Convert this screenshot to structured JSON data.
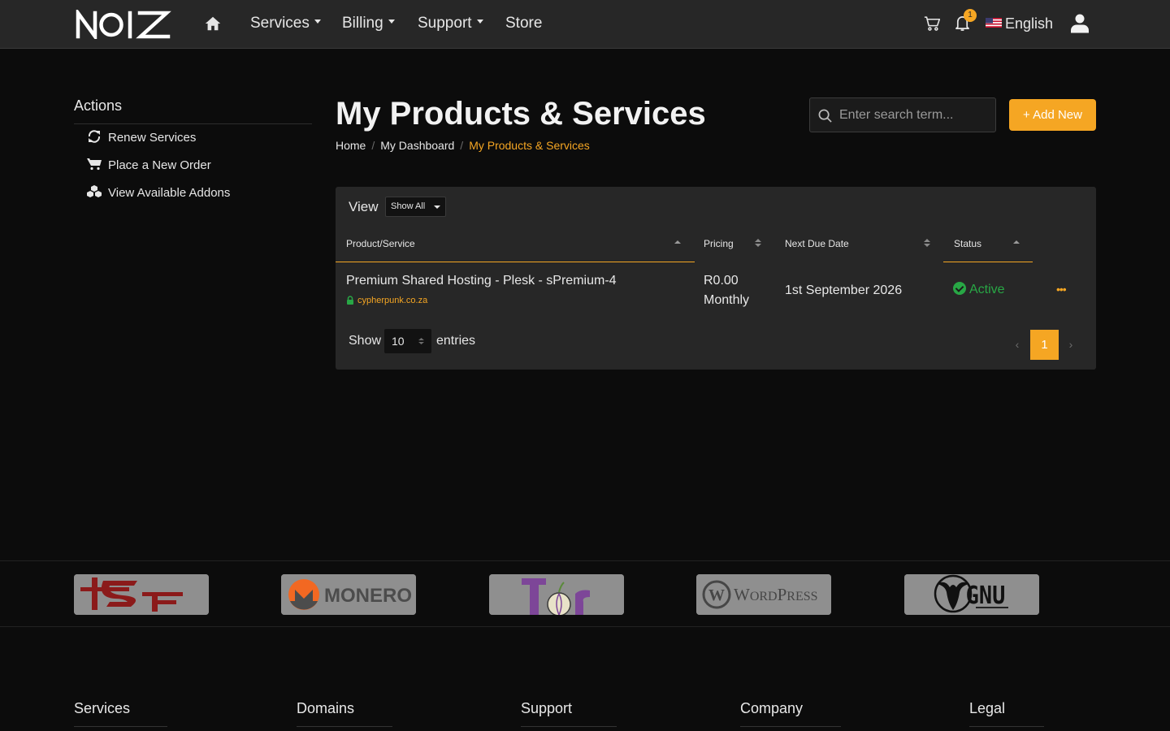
{
  "brand": {
    "logo_text": "NOIZ"
  },
  "nav": {
    "items": [
      {
        "label": "Services",
        "dropdown": true
      },
      {
        "label": "Billing",
        "dropdown": true
      },
      {
        "label": "Support",
        "dropdown": true
      },
      {
        "label": "Store",
        "dropdown": false
      }
    ],
    "notification_count": "1",
    "language": "English",
    "icons": [
      "home-icon",
      "cart-icon",
      "bell-icon",
      "us-flag-icon",
      "user-icon"
    ]
  },
  "sidebar": {
    "title": "Actions",
    "items": [
      {
        "label": "Renew Services",
        "icon": "refresh-icon"
      },
      {
        "label": "Place a New Order",
        "icon": "cart-icon"
      },
      {
        "label": "View Available Addons",
        "icon": "cubes-icon"
      }
    ]
  },
  "header": {
    "title": "My Products & Services",
    "breadcrumb": [
      "Home",
      "My Dashboard",
      "My Products & Services"
    ],
    "search_placeholder": "Enter search term...",
    "add_new_label": "+ Add New"
  },
  "table": {
    "view_label": "View",
    "view_filter": "Show All",
    "columns": [
      "Product/Service",
      "Pricing",
      "Next Due Date",
      "Status"
    ],
    "rows": [
      {
        "product": "Premium Shared Hosting - Plesk - sPremium-4",
        "domain": "cypherpunk.co.za",
        "price": "R0.00",
        "cycle": "Monthly",
        "next_due": "1st September 2026",
        "status": "Active"
      }
    ],
    "show_label": "Show",
    "entries_value": "10",
    "entries_label": "entries",
    "pagination": {
      "prev": "‹",
      "current": "1",
      "next": "›"
    }
  },
  "partners": [
    "FSF",
    "MONERO",
    "Tor",
    "WordPress",
    "GNU"
  ],
  "footer": {
    "columns": [
      "Services",
      "Domains",
      "Support",
      "Company",
      "Legal"
    ]
  },
  "colors": {
    "accent": "#f5a623",
    "background": "#0c0c0c",
    "navbar": "#272727",
    "card": "#272727",
    "active": "#28a745"
  }
}
